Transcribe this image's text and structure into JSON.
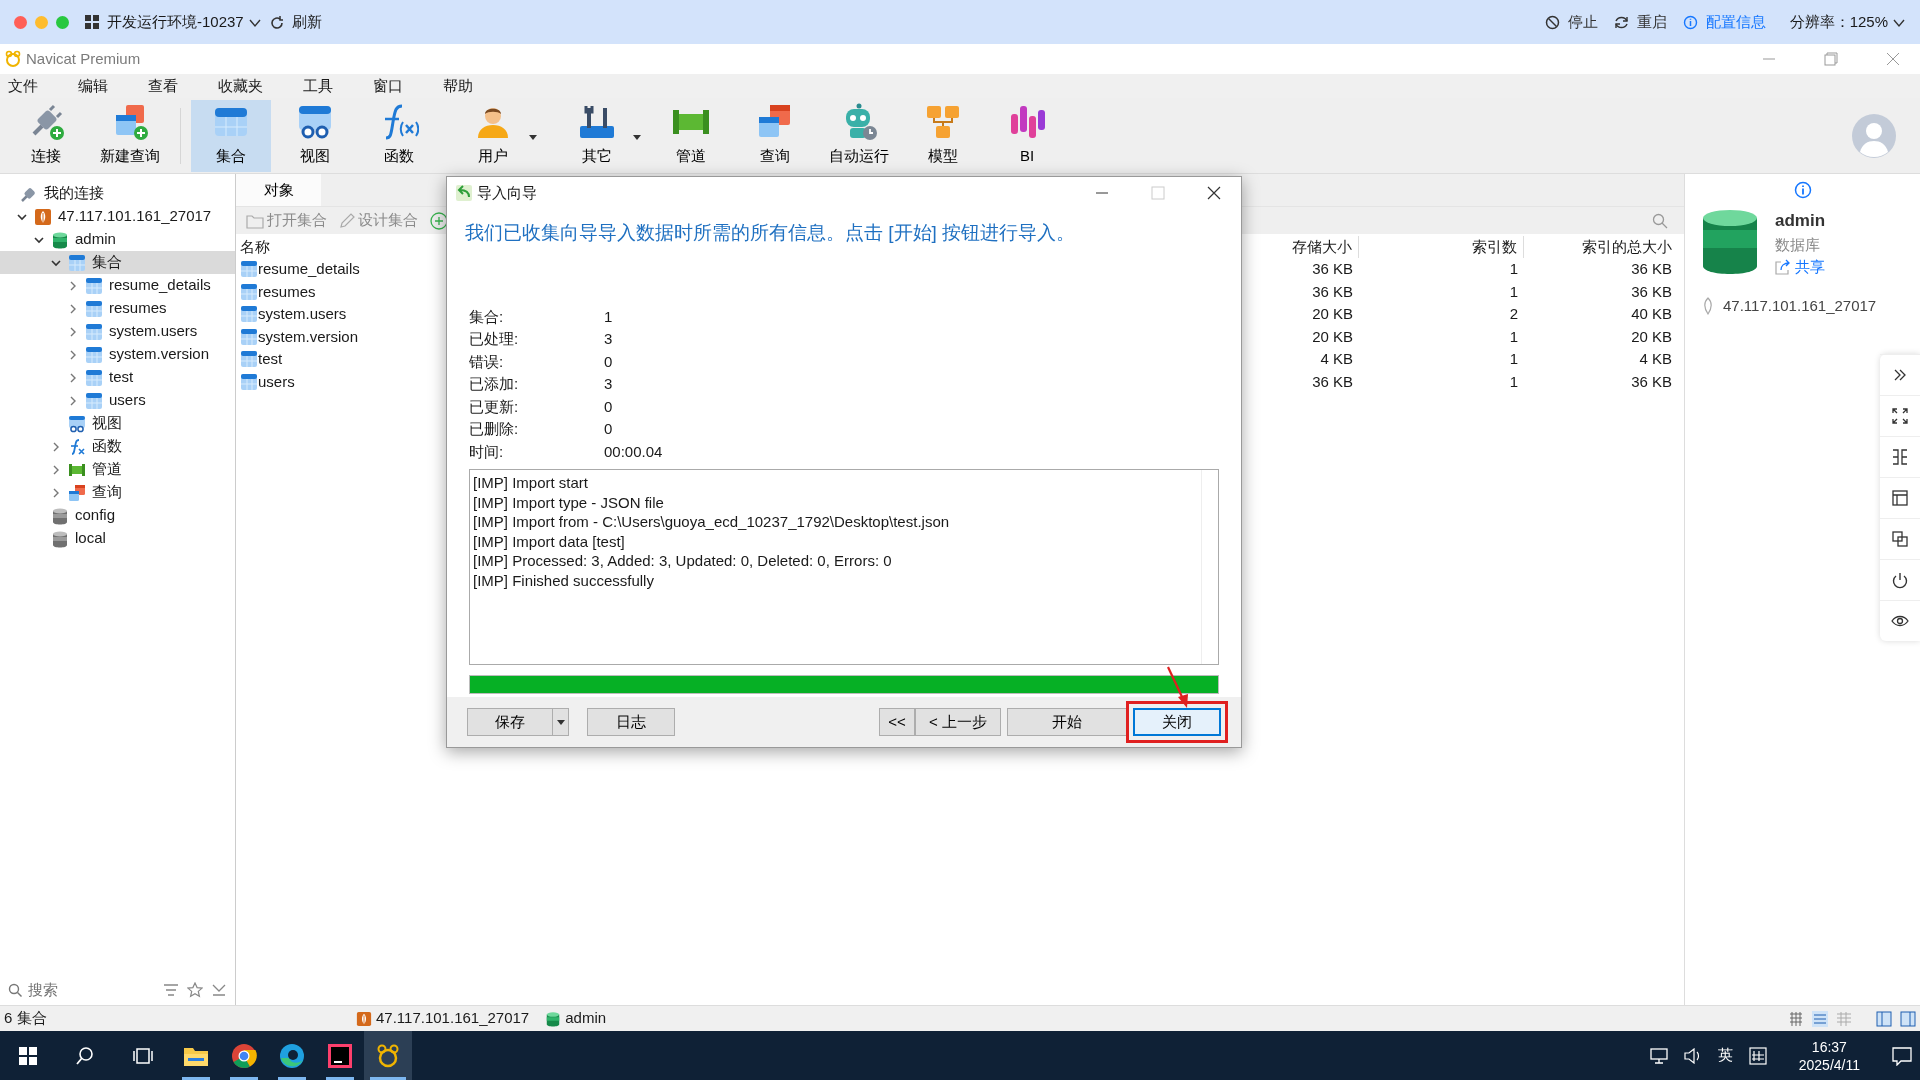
{
  "shell": {
    "title": "开发运行环境-10237",
    "refresh": "刷新",
    "actions": [
      {
        "label": "停止",
        "kind": "stop"
      },
      {
        "label": "重启",
        "kind": "restart"
      },
      {
        "label": "配置信息",
        "kind": "info"
      }
    ],
    "resolution": "分辨率：125%"
  },
  "window": {
    "title": "Navicat Premium"
  },
  "menu": [
    "文件",
    "编辑",
    "查看",
    "收藏夹",
    "工具",
    "窗口",
    "帮助"
  ],
  "toolbar": [
    {
      "label": "连接",
      "kind": "connect",
      "selected": false,
      "dropdown": false
    },
    {
      "label": "新建查询",
      "kind": "newquery",
      "selected": false,
      "dropdown": false
    },
    {
      "label": "集合",
      "kind": "collection",
      "selected": true,
      "dropdown": false
    },
    {
      "label": "视图",
      "kind": "view",
      "selected": false,
      "dropdown": false
    },
    {
      "label": "函数",
      "kind": "function",
      "selected": false,
      "dropdown": false
    },
    {
      "label": "用户",
      "kind": "user",
      "selected": false,
      "dropdown": true
    },
    {
      "label": "其它",
      "kind": "tools",
      "selected": false,
      "dropdown": true
    },
    {
      "label": "管道",
      "kind": "pipeline",
      "selected": false,
      "dropdown": false
    },
    {
      "label": "查询",
      "kind": "query",
      "selected": false,
      "dropdown": false
    },
    {
      "label": "自动运行",
      "kind": "robot",
      "selected": false,
      "dropdown": false
    },
    {
      "label": "模型",
      "kind": "model",
      "selected": false,
      "dropdown": false
    },
    {
      "label": "BI",
      "kind": "bi",
      "selected": false,
      "dropdown": false
    }
  ],
  "sidebar": {
    "header": "我的连接",
    "tree": [
      {
        "label": "47.117.101.161_27017",
        "kind": "connection",
        "expanded": true,
        "selected": false,
        "children": [
          {
            "label": "admin",
            "kind": "database",
            "expanded": true,
            "selected": false,
            "children": [
              {
                "label": "集合",
                "kind": "collection",
                "expanded": true,
                "selected": true,
                "children": [
                  {
                    "label": "resume_details",
                    "kind": "collection",
                    "expanded": false,
                    "selected": false
                  },
                  {
                    "label": "resumes",
                    "kind": "collection",
                    "expanded": false,
                    "selected": false
                  },
                  {
                    "label": "system.users",
                    "kind": "collection",
                    "expanded": false,
                    "selected": false
                  },
                  {
                    "label": "system.version",
                    "kind": "collection",
                    "expanded": false,
                    "selected": false
                  },
                  {
                    "label": "test",
                    "kind": "collection",
                    "expanded": false,
                    "selected": false
                  },
                  {
                    "label": "users",
                    "kind": "collection",
                    "expanded": false,
                    "selected": false
                  }
                ]
              },
              {
                "label": "视图",
                "kind": "view",
                "selected": false
              },
              {
                "label": "函数",
                "kind": "function",
                "expanded": false,
                "selected": false
              },
              {
                "label": "管道",
                "kind": "pipeline",
                "expanded": false,
                "selected": false
              },
              {
                "label": "查询",
                "kind": "query",
                "expanded": false,
                "selected": false
              }
            ]
          },
          {
            "label": "config",
            "kind": "database-grey",
            "selected": false
          },
          {
            "label": "local",
            "kind": "database-grey",
            "selected": false
          }
        ]
      }
    ],
    "search": {
      "placeholder": "搜索"
    }
  },
  "tabs": [
    {
      "label": "对象",
      "selected": true
    }
  ],
  "object_toolbar": [
    {
      "label": "打开集合",
      "kind": "open"
    },
    {
      "label": "设计集合",
      "kind": "design"
    },
    {
      "kind": "add"
    }
  ],
  "table": {
    "columns": [
      "名称",
      "存储大小",
      "索引数",
      "索引的总大小"
    ],
    "rows": [
      [
        "resume_details",
        "36 KB",
        "1",
        "36 KB"
      ],
      [
        "resumes",
        "36 KB",
        "1",
        "36 KB"
      ],
      [
        "system.users",
        "20 KB",
        "2",
        "40 KB"
      ],
      [
        "system.version",
        "20 KB",
        "1",
        "20 KB"
      ],
      [
        "test",
        "4 KB",
        "1",
        "4 KB"
      ],
      [
        "users",
        "36 KB",
        "1",
        "36 KB"
      ]
    ]
  },
  "info_panel": {
    "name": "admin",
    "type": "数据库",
    "share": "共享",
    "connection": "47.117.101.161_27017"
  },
  "dialog": {
    "title": "导入向导",
    "heading": "我们已收集向导导入数据时所需的所有信息。点击 [开始] 按钮进行导入。",
    "stats": [
      {
        "label": "集合:",
        "value": "1"
      },
      {
        "label": "已处理:",
        "value": "3"
      },
      {
        "label": "错误:",
        "value": "0"
      },
      {
        "label": "已添加:",
        "value": "3"
      },
      {
        "label": "已更新:",
        "value": "0"
      },
      {
        "label": "已删除:",
        "value": "0"
      },
      {
        "label": "时间:",
        "value": "00:00.04"
      }
    ],
    "log": [
      "[IMP] Import start",
      "[IMP] Import type - JSON file",
      "[IMP] Import from - C:\\Users\\guoya_ecd_10237_1792\\Desktop\\test.json",
      "[IMP] Import data [test]",
      "[IMP] Processed: 3, Added: 3, Updated: 0, Deleted: 0, Errors: 0",
      "[IMP] Finished successfully"
    ],
    "progress": {
      "level": 1
    },
    "buttons": [
      {
        "label": "保存",
        "kind": "split",
        "highlighted": false
      },
      {
        "label": "日志",
        "kind": "plain",
        "highlighted": false
      },
      {
        "label": "<<",
        "kind": "plain",
        "highlighted": false
      },
      {
        "label": "< 上一步",
        "kind": "plain",
        "highlighted": false
      },
      {
        "label": "开始",
        "kind": "plain",
        "highlighted": false
      },
      {
        "label": "关闭",
        "kind": "plain",
        "highlighted": true
      }
    ]
  },
  "status_bar": {
    "count": "6 集合",
    "connection": "47.117.101.161_27017",
    "database": "admin"
  },
  "taskbar": {
    "apps": [
      {
        "kind": "folder",
        "selected": false
      },
      {
        "kind": "chrome",
        "selected": false
      },
      {
        "kind": "edge",
        "selected": false
      },
      {
        "kind": "ide",
        "selected": false
      },
      {
        "kind": "navicat",
        "selected": true
      }
    ],
    "language": "英",
    "time": "16:37",
    "date": "2025/4/11"
  }
}
